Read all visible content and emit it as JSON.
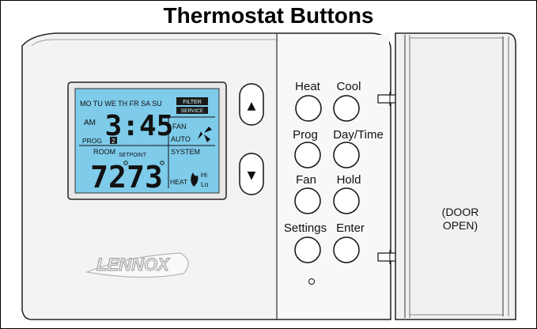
{
  "title": "Thermostat Buttons",
  "brand": "LENNOX",
  "display": {
    "days": "MO TU WE TH FR SA SU",
    "filter": "FILTER",
    "service": "SERVICE",
    "am": "AM",
    "time": "3:45",
    "prog": "PROG",
    "prog_num": "2",
    "fan": "FAN",
    "auto": "AUTO",
    "room": "ROOM",
    "setpoint": "SETPOINT",
    "system": "SYSTEM",
    "room_temp": "72",
    "set_temp": "73",
    "heat": "HEAT",
    "hi": "Hi",
    "lo": "Lo"
  },
  "arrows": {
    "up": "▲",
    "down": "▼"
  },
  "buttons": {
    "heat": "Heat",
    "cool": "Cool",
    "prog": "Prog",
    "daytime": "Day/Time",
    "fan": "Fan",
    "hold": "Hold",
    "settings": "Settings",
    "enter": "Enter"
  },
  "door": {
    "line1": "(DOOR",
    "line2": "OPEN)"
  },
  "colors": {
    "lcd": "#7ecbea",
    "housing": "#f2f2f2",
    "outline": "#222222"
  }
}
